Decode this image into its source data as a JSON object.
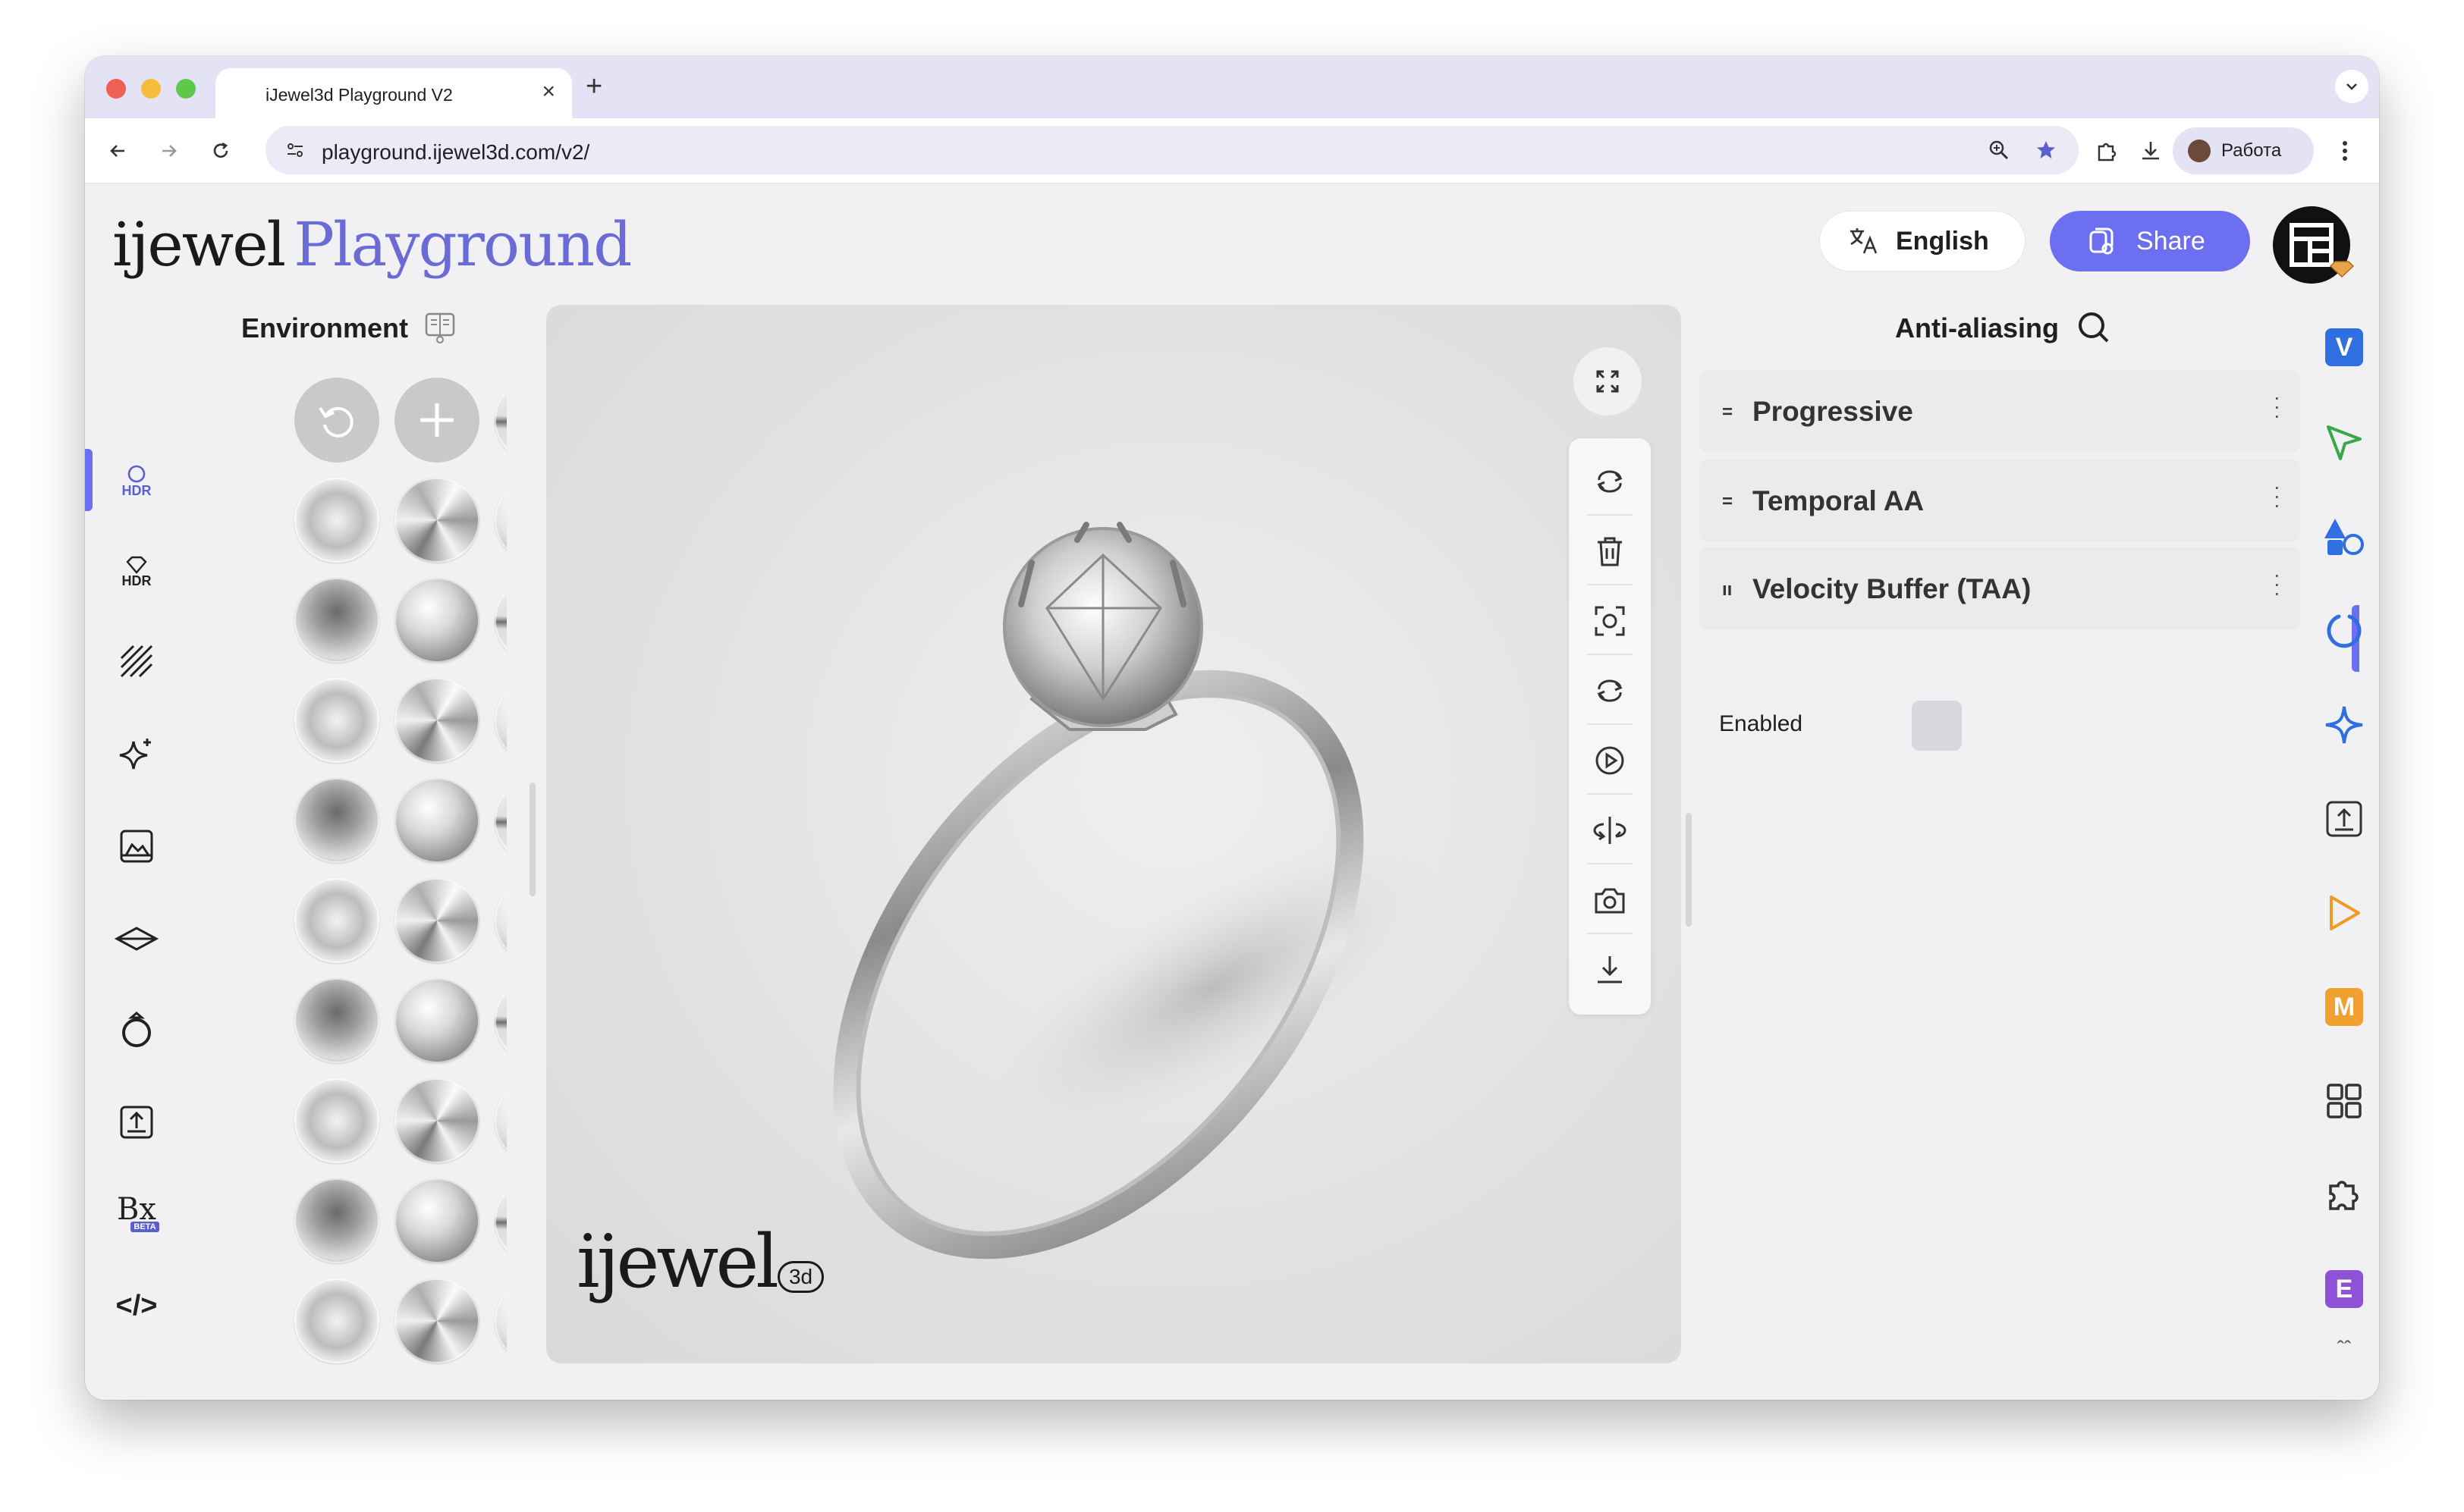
{
  "browser": {
    "tab_title": "iJewel3d Playground V2",
    "tab_close": "×",
    "new_tab": "+",
    "url": "playground.ijewel3d.com/v2/",
    "profile_name": "Работа"
  },
  "header": {
    "logo_primary": "ijewel",
    "logo_secondary": "Playground",
    "language_label": "English",
    "share_label": "Share"
  },
  "left_rail": {
    "items": [
      {
        "icon": "hdr-circle-icon",
        "text": "HDR"
      },
      {
        "icon": "hdr-diamond-icon",
        "text": "HDR"
      },
      {
        "icon": "stripes-icon",
        "text": ""
      },
      {
        "icon": "sparkle-icon",
        "text": ""
      },
      {
        "icon": "image-frame-icon",
        "text": ""
      },
      {
        "icon": "plane-icon",
        "text": ""
      },
      {
        "icon": "ring-icon",
        "text": ""
      },
      {
        "icon": "export-icon",
        "text": ""
      },
      {
        "icon": "bx-icon",
        "text": "Bx",
        "badge": "BETA"
      },
      {
        "icon": "code-icon",
        "text": "</>"
      },
      {
        "icon": "collapse-icon",
        "text": "«"
      }
    ]
  },
  "environment": {
    "title": "Environment",
    "delete_label": "×"
  },
  "viewport": {
    "watermark": "ijewel",
    "watermark_suffix": "3d"
  },
  "anti_aliasing": {
    "title": "Anti-aliasing",
    "plugins": [
      {
        "handle": "=",
        "label": "Progressive"
      },
      {
        "handle": "=",
        "label": "Temporal AA"
      },
      {
        "handle": "ıı",
        "label": "Velocity Buffer (TAA)"
      }
    ],
    "enabled_label": "Enabled",
    "enabled_value": false
  },
  "right_rail": {
    "items": [
      {
        "icon": "v-badge-icon",
        "text": "V",
        "color": "#2f6fe0"
      },
      {
        "icon": "pointer-icon",
        "text": "",
        "color": "#3aa74a"
      },
      {
        "icon": "shapes-icon",
        "text": "",
        "color": "#2f6fe0"
      },
      {
        "icon": "ring-outline-icon",
        "text": "",
        "color": "#2f6fe0"
      },
      {
        "icon": "star4-icon",
        "text": "",
        "color": "#2f6fe0"
      },
      {
        "icon": "upload-box-icon",
        "text": "",
        "color": "#333333"
      },
      {
        "icon": "play-icon",
        "text": "",
        "color": "#f09a2a"
      },
      {
        "icon": "m-badge-icon",
        "text": "M",
        "color": "#f0a030"
      },
      {
        "icon": "grid-icon",
        "text": "",
        "color": "#333333"
      },
      {
        "icon": "puzzle-icon",
        "text": "",
        "color": "#333333"
      },
      {
        "icon": "e-badge-icon",
        "text": "E",
        "color": "#8e52d6"
      }
    ]
  },
  "colors": {
    "accent": "#6b6ff0",
    "panel_bg": "#f1f1f3"
  }
}
